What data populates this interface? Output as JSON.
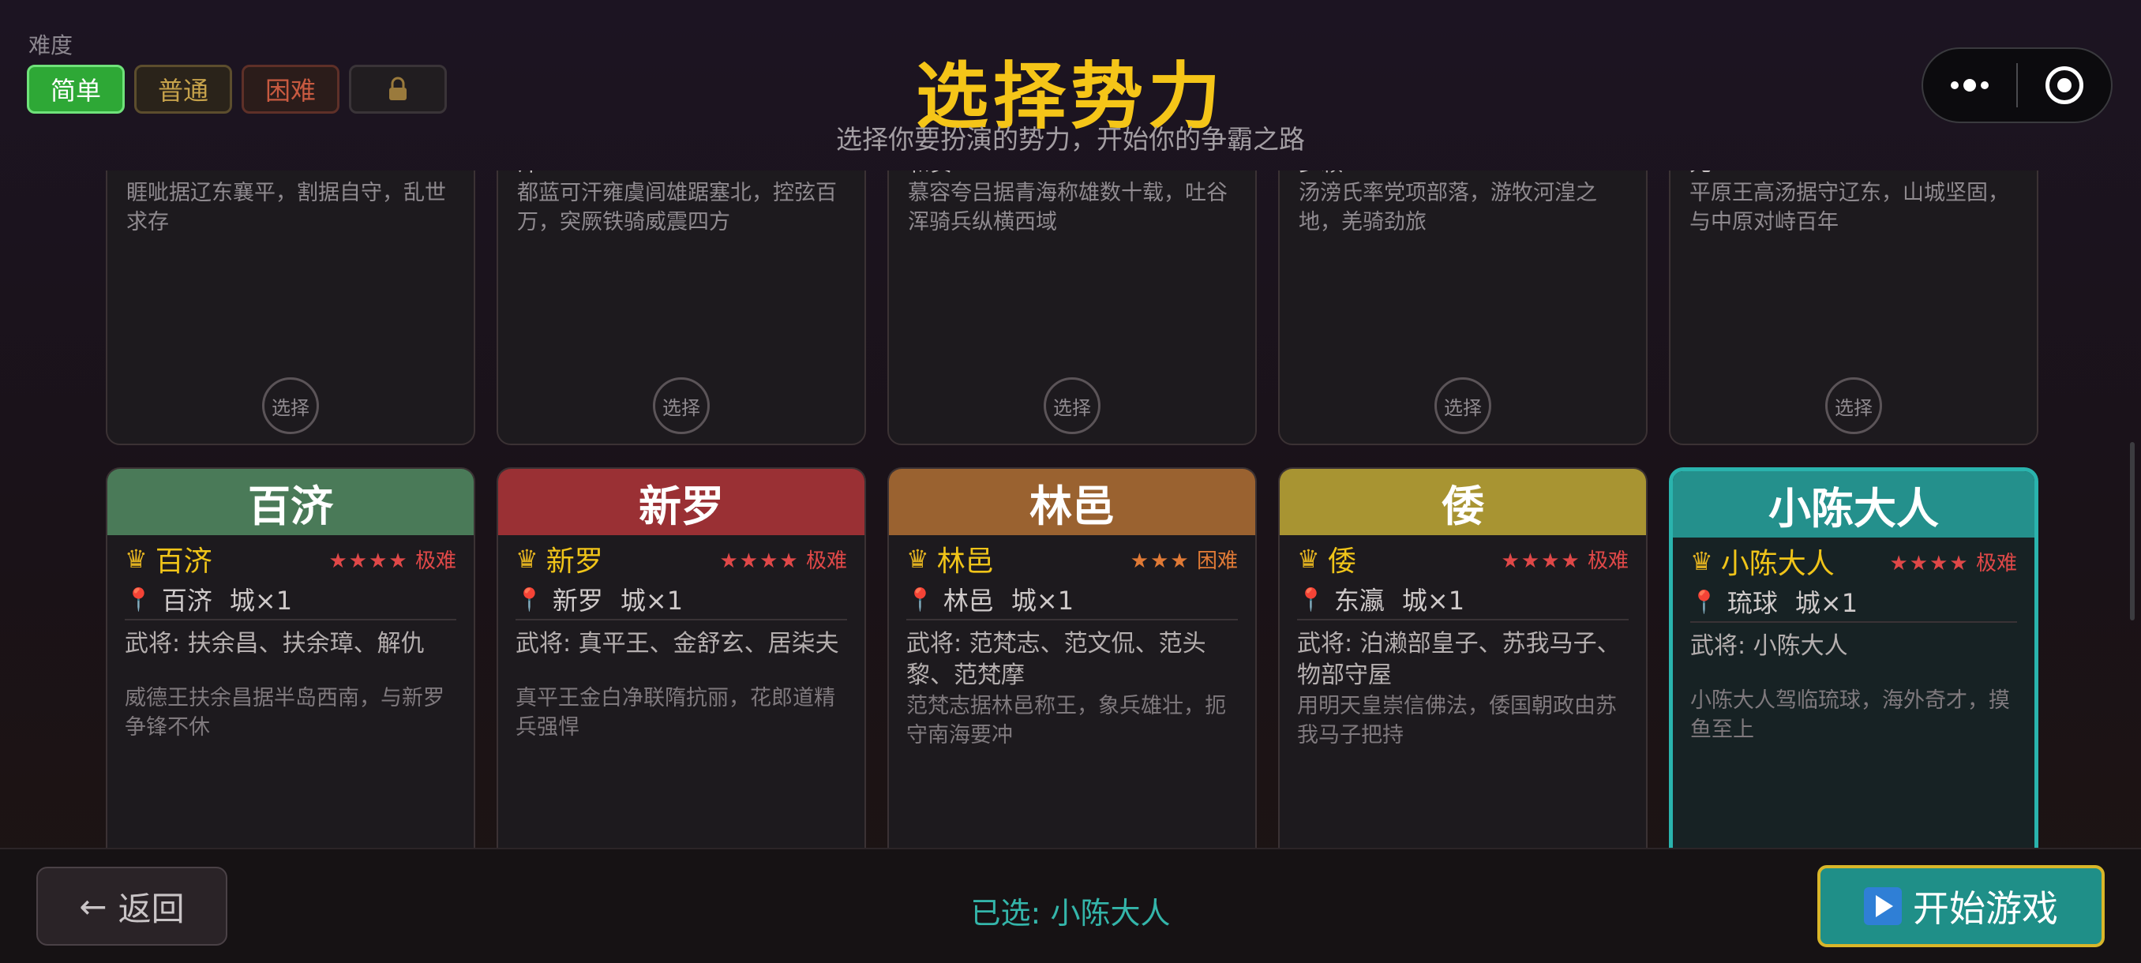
{
  "difficulty": {
    "label": "难度",
    "options": [
      "简单",
      "普通",
      "困难"
    ],
    "selected": "简单",
    "locked_icon": "lock-icon"
  },
  "header": {
    "title": "选择势力",
    "subtitle": "选择你要扮演的势力，开始你的争霸之路"
  },
  "capsule": {
    "more_icon": "more-dots-icon",
    "close_icon": "target-icon"
  },
  "top_row": [
    {
      "title_fragment": "",
      "desc": "睚呲据辽东襄平，割据自守，乱世求存",
      "select_label": "选择"
    },
    {
      "title_fragment": "汗",
      "desc": "都蓝可汗雍虞闾雄踞塞北，控弦百万，突厥铁骑威震四方",
      "select_label": "选择"
    },
    {
      "title_fragment": "和贵",
      "desc": "慕容夸吕据青海称雄数十载，吐谷浑骑兵纵横西域",
      "select_label": "选择"
    },
    {
      "title_fragment": "步赖",
      "desc": "汤滂氏率党项部落，游牧河湟之地，羌骑劲旅",
      "select_label": "选择"
    },
    {
      "title_fragment": "元",
      "desc": "平原王高汤据守辽东，山城坚固，与中原对峙百年",
      "select_label": "选择"
    }
  ],
  "factions": [
    {
      "name": "百济",
      "header_color": "#4a7a58",
      "ruler": "百济",
      "stars": "★★★★",
      "difficulty": "极难",
      "diff_color": "#e04848",
      "city": "百济",
      "city_count": "城×1",
      "generals": "武将: 扶余昌、扶余璋、解仇",
      "desc": "威德王扶余昌据半岛西南，与新罗争锋不休"
    },
    {
      "name": "新罗",
      "header_color": "#9a3034",
      "ruler": "新罗",
      "stars": "★★★★",
      "difficulty": "极难",
      "diff_color": "#e04848",
      "city": "新罗",
      "city_count": "城×1",
      "generals": "武将: 真平王、金舒玄、居柒夫",
      "desc": "真平王金白净联隋抗丽，花郎道精兵强悍"
    },
    {
      "name": "林邑",
      "header_color": "#9a6230",
      "ruler": "林邑",
      "stars": "★★★",
      "difficulty": "困难",
      "diff_color": "#e07a36",
      "city": "林邑",
      "city_count": "城×1",
      "generals": "武将: 范梵志、范文侃、范头黎、范梵摩",
      "desc": "范梵志据林邑称王，象兵雄壮，扼守南海要冲"
    },
    {
      "name": "倭",
      "header_color": "#a89432",
      "ruler": "倭",
      "stars": "★★★★",
      "difficulty": "极难",
      "diff_color": "#e04848",
      "city": "东瀛",
      "city_count": "城×1",
      "generals": "武将: 泊濑部皇子、苏我马子、物部守屋",
      "desc": "用明天皇崇信佛法，倭国朝政由苏我马子把持"
    },
    {
      "name": "小陈大人",
      "header_color": "#24908c",
      "ruler": "小陈大人",
      "stars": "★★★★",
      "difficulty": "极难",
      "diff_color": "#e04848",
      "city": "琉球",
      "city_count": "城×1",
      "generals": "武将: 小陈大人",
      "desc": "小陈大人驾临琉球，海外奇才，摸鱼至上"
    }
  ],
  "footer": {
    "back_label": "返回",
    "selected_prefix": "已选: ",
    "selected_name": "小陈大人",
    "start_label": "开始游戏"
  }
}
